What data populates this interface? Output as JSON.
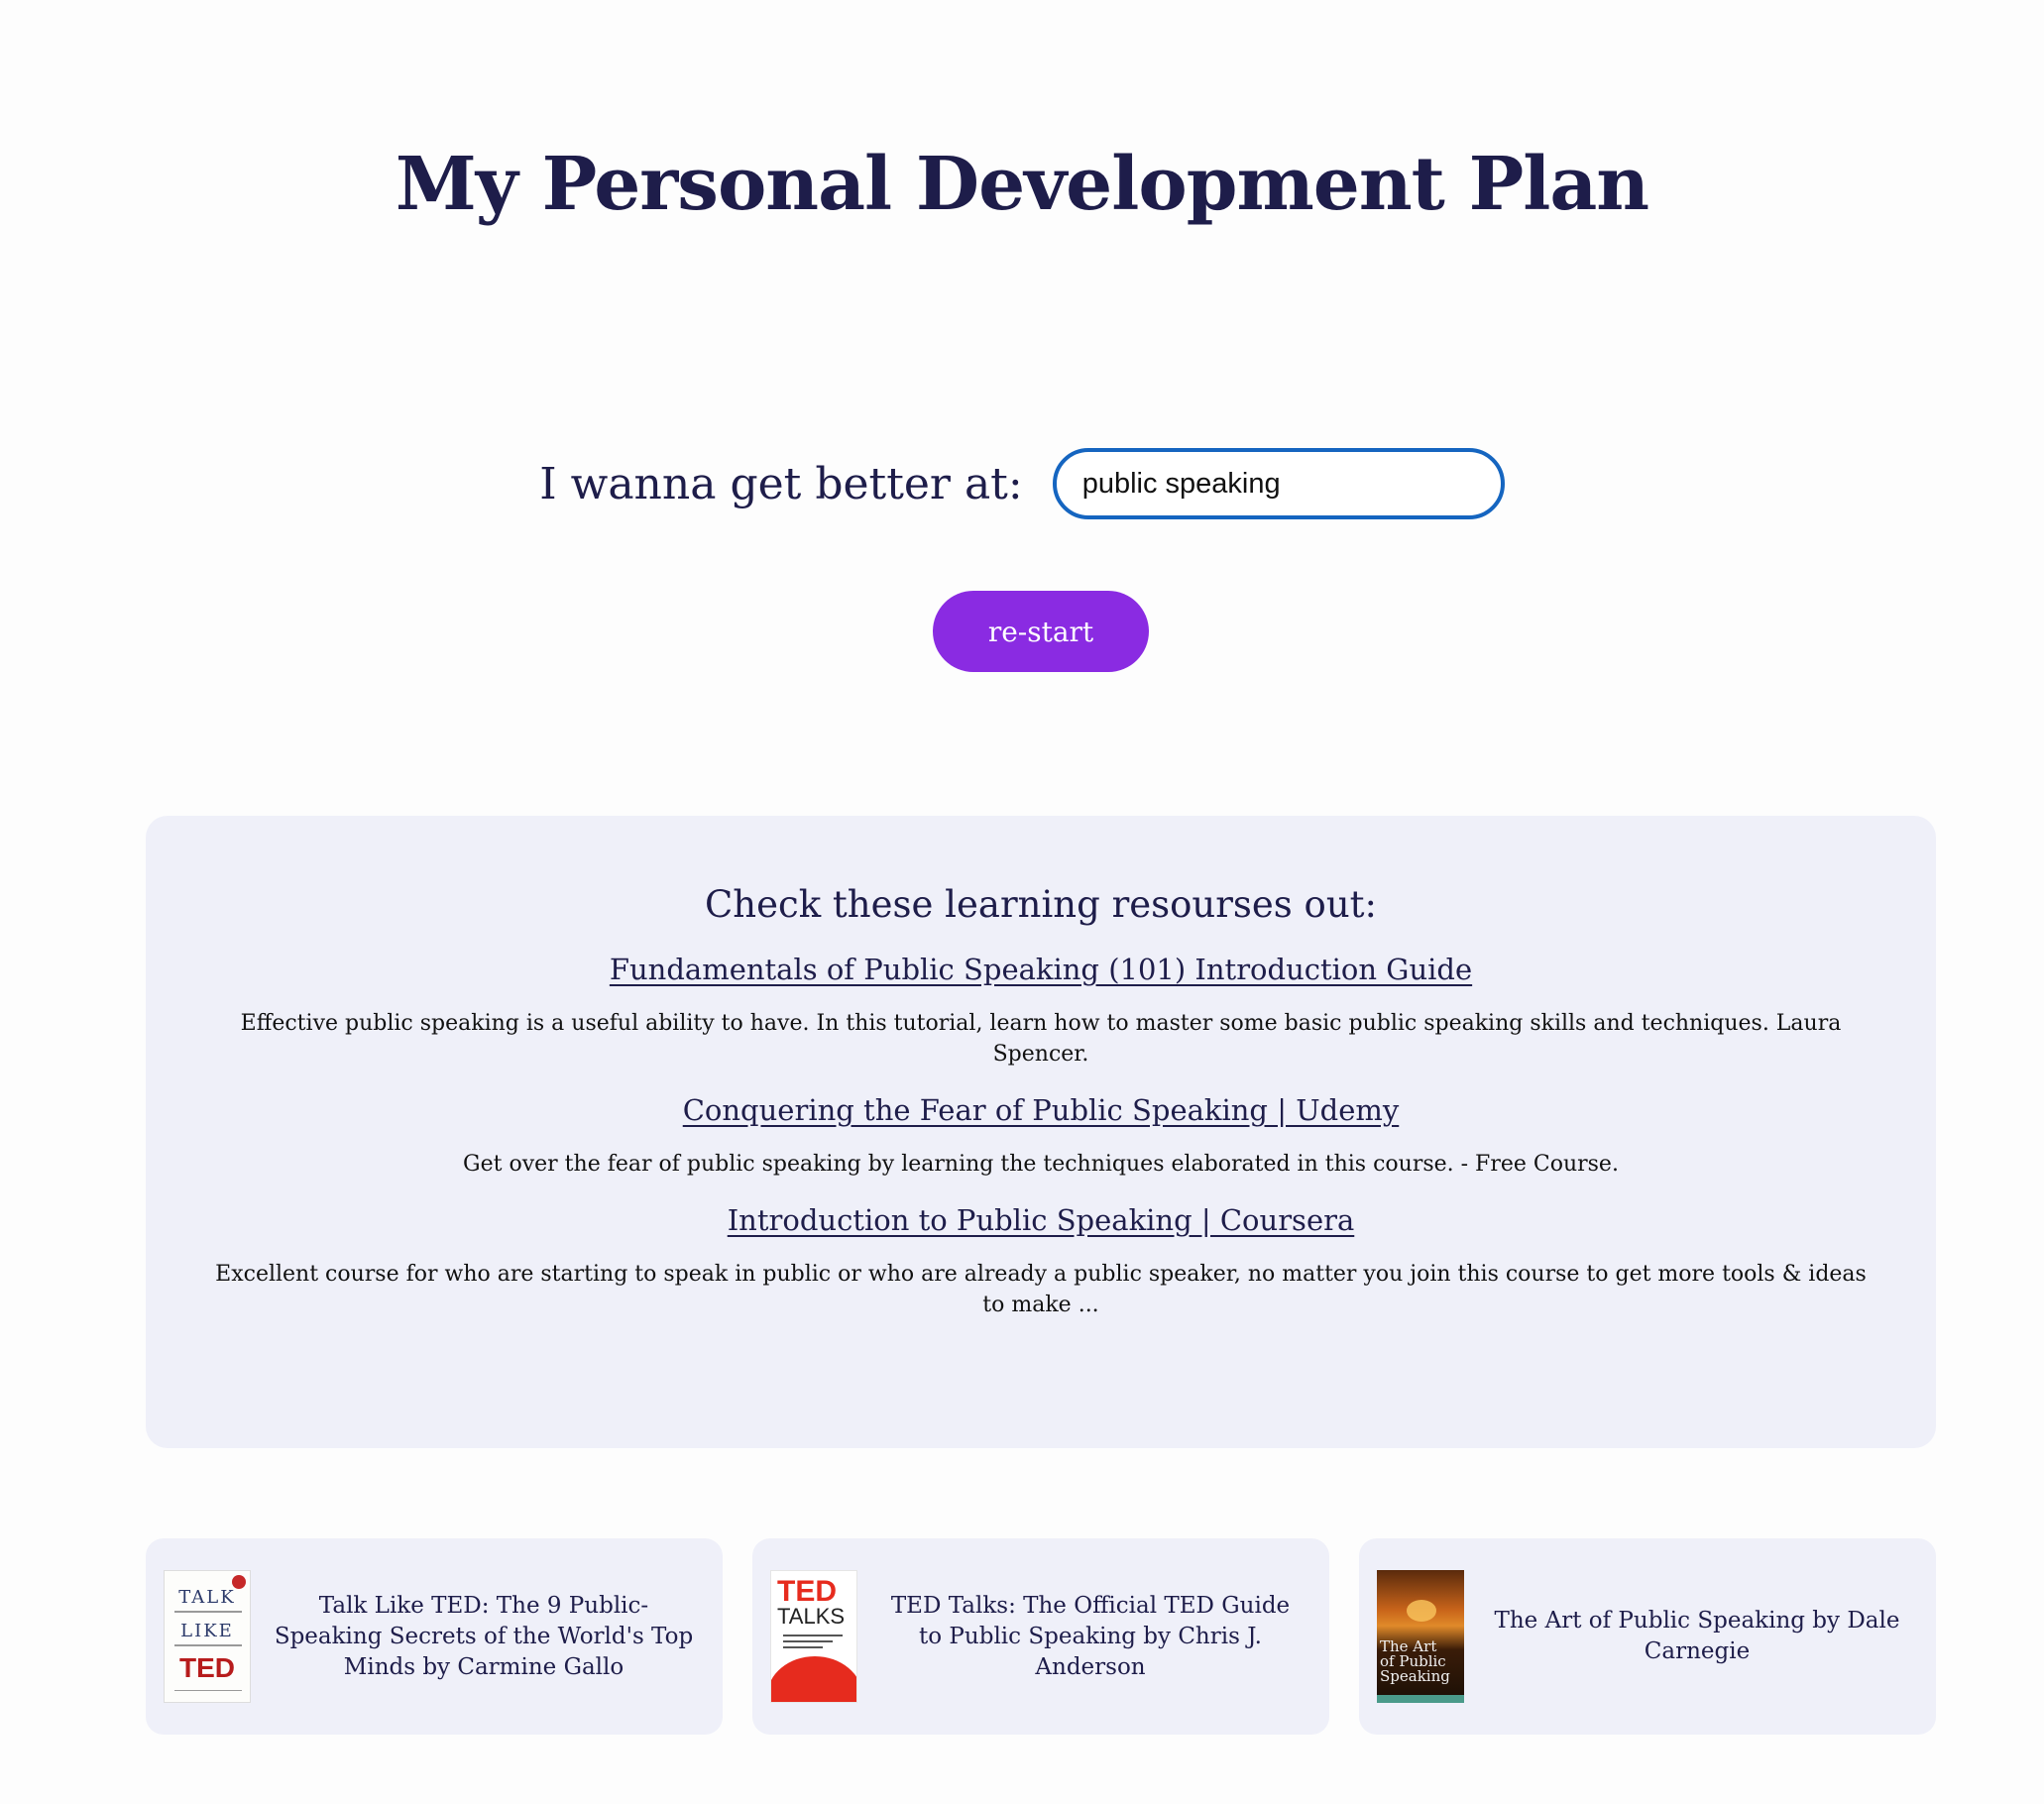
{
  "page": {
    "title": "My Personal Development Plan"
  },
  "goal": {
    "label": "I wanna get better at:",
    "input_value": "public speaking"
  },
  "restart_button": {
    "label": "re-start"
  },
  "resources": {
    "heading": "Check these learning resourses out:",
    "items": [
      {
        "title": "Fundamentals of Public Speaking (101) Introduction Guide",
        "description": "Effective public speaking is a useful ability to have. In this tutorial, learn how to master some basic public speaking skills and techniques. Laura Spencer."
      },
      {
        "title": "Conquering the Fear of Public Speaking | Udemy",
        "description": "Get over the fear of public speaking by learning the techniques elaborated in this course. - Free Course."
      },
      {
        "title": "Introduction to Public Speaking | Coursera",
        "description": "Excellent course for who are starting to speak in public or who are already a public speaker, no matter you join this course to get more tools & ideas to make ..."
      }
    ]
  },
  "books": [
    {
      "title": "Talk Like TED: The 9 Public-Speaking Secrets of the World's Top Minds by Carmine Gallo",
      "cover_text": [
        "TALK",
        "LIKE",
        "TED"
      ]
    },
    {
      "title": "TED Talks: The Official TED Guide to Public Speaking by Chris J. Anderson",
      "cover_text": [
        "TED",
        "TALKS"
      ]
    },
    {
      "title": "The Art of Public Speaking by Dale Carnegie",
      "cover_text": [
        "The Art",
        "of Public",
        "Speaking"
      ]
    }
  ],
  "colors": {
    "title": "#1e1d4a",
    "accent_button": "#8a2be2",
    "input_border": "#1565c0",
    "panel_background": "#eff0f9"
  }
}
